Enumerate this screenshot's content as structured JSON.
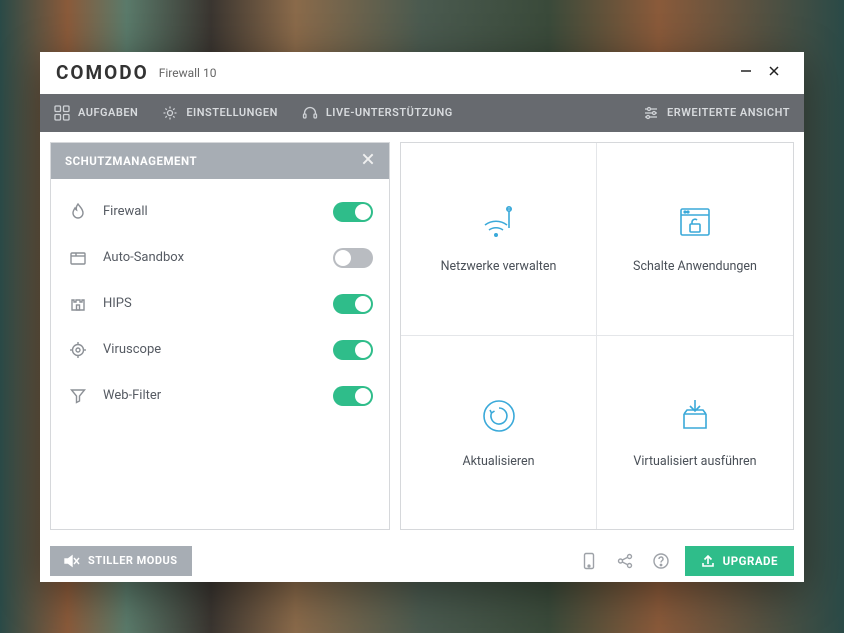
{
  "brand": {
    "name": "COMODO",
    "product": "Firewall",
    "version": "10"
  },
  "toolbar": {
    "tasks": "AUFGABEN",
    "settings": "EINSTELLUNGEN",
    "support": "LIVE-UNTERSTÜTZUNG",
    "advanced": "ERWEITERTE ANSICHT"
  },
  "protection": {
    "title": "SCHUTZMANAGEMENT",
    "items": [
      {
        "label": "Firewall",
        "on": true,
        "icon": "flame-icon"
      },
      {
        "label": "Auto-Sandbox",
        "on": false,
        "icon": "box-icon"
      },
      {
        "label": "HIPS",
        "on": true,
        "icon": "castle-icon"
      },
      {
        "label": "Viruscope",
        "on": true,
        "icon": "target-icon"
      },
      {
        "label": "Web-Filter",
        "on": true,
        "icon": "funnel-icon"
      }
    ]
  },
  "tiles": [
    {
      "label": "Netzwerke verwalten",
      "icon": "wifi-icon"
    },
    {
      "label": "Schalte Anwendungen",
      "icon": "unlock-window-icon"
    },
    {
      "label": "Aktualisieren",
      "icon": "refresh-icon"
    },
    {
      "label": "Virtualisiert ausführen",
      "icon": "download-box-icon"
    }
  ],
  "footer": {
    "silent": "STILLER MODUS",
    "upgrade": "UPGRADE"
  },
  "colors": {
    "accent": "#2fbd8a",
    "tile": "#3aa9d9"
  }
}
